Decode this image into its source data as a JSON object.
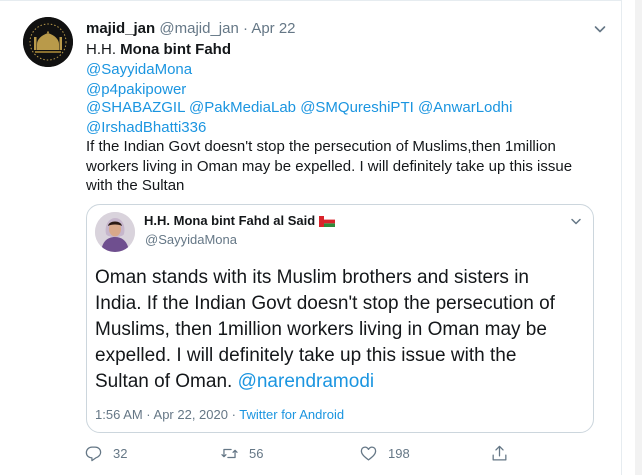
{
  "tweet": {
    "author_name": "majid_jan",
    "author_handle": "@majid_jan",
    "separator": "·",
    "date": "Apr 22",
    "to_prefix": "H.H. ",
    "to_name": "Mona bint Fahd",
    "mentions": {
      "line1": "@SayyidaMona",
      "line2": "@p4pakipower",
      "line3": [
        "@SHABAZGIL",
        "@PakMediaLab",
        "@SMQureshiPTI",
        "@AnwarLodhi"
      ],
      "line4": "@IrshadBhatti336"
    },
    "text_lines": [
      "If the Indian Govt doesn't stop the persecution of Muslims,then 1million",
      "workers living in Oman may be expelled. I will definitely take up this issue",
      "with the Sultan"
    ]
  },
  "quoted": {
    "name": "H.H. Mona bint Fahd al Said",
    "handle": "@SayyidaMona",
    "text_lines": [
      "Oman stands with its Muslim brothers and sisters in",
      "India. If the Indian Govt doesn't stop the persecution of",
      "Muslims, then 1million workers living in Oman may be",
      "expelled. I will definitely take up this issue with the",
      "Sultan of Oman. "
    ],
    "text_mention": "@narendramodi",
    "time": "1:56 AM · Apr 22, 2020 · ",
    "source": "Twitter for Android"
  },
  "actions": {
    "reply_count": "32",
    "retweet_count": "56",
    "like_count": "198"
  },
  "colors": {
    "link": "#1b95e0",
    "muted": "#657786",
    "text": "#14171a",
    "border": "#ccd6dd"
  },
  "icons": {
    "author_avatar": "mosque-silhouette-avatar",
    "flag": "oman-flag-icon",
    "reply": "reply-icon",
    "retweet": "retweet-icon",
    "like": "heart-icon",
    "share": "share-icon",
    "menu": "chevron-down-icon"
  }
}
